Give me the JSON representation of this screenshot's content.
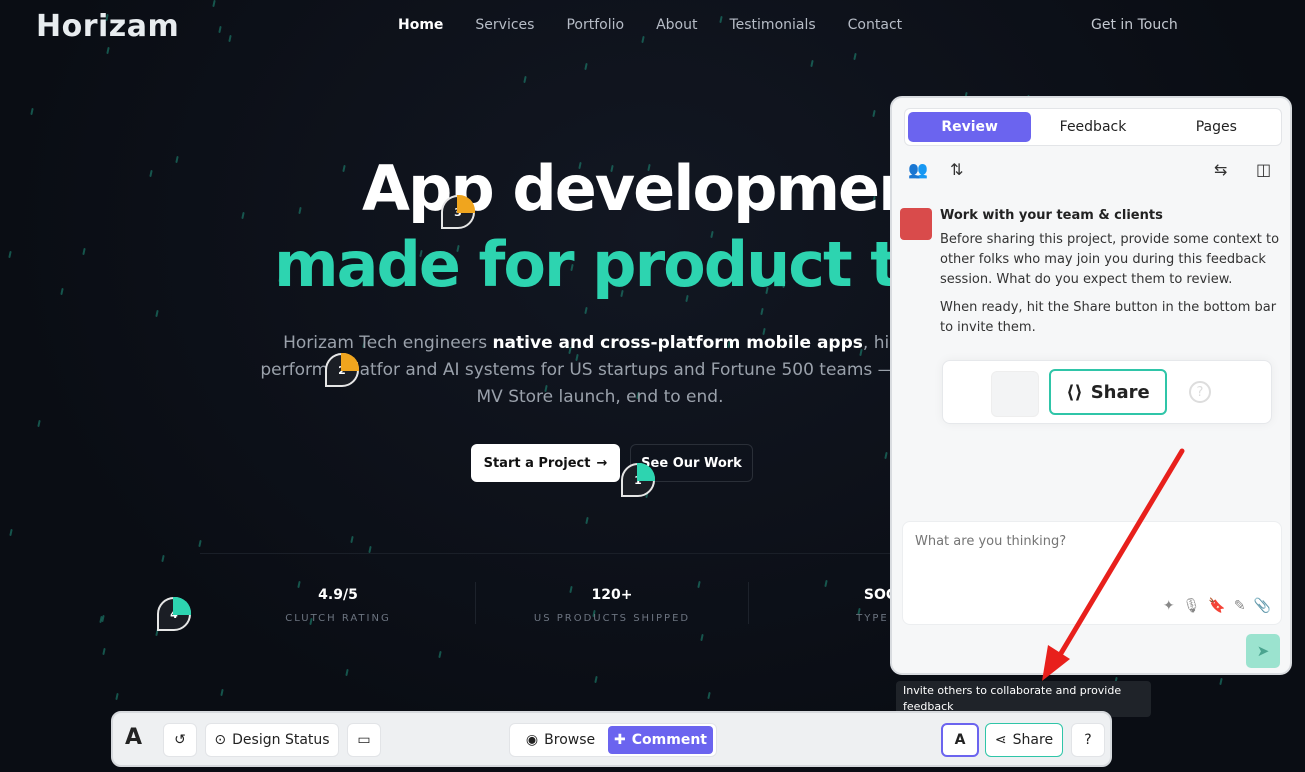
{
  "site": {
    "logo": "Horizam",
    "nav": [
      "Home",
      "Services",
      "Portfolio",
      "About",
      "Testimonials",
      "Contact"
    ],
    "cta": "Get in Touch",
    "hero_line1": "App development",
    "hero_line2": "made for product tear",
    "sub_pre": "Horizam Tech engineers ",
    "sub_bold": "native and cross-platform mobile apps",
    "sub_post": ", high-performa platfor   and AI systems for US startups and Fortune 500 teams — from MV Store launch, end to end.",
    "btn_start": "Start a Project",
    "btn_work": "See Our Work",
    "stats": [
      {
        "value": "4.9/5",
        "label": "CLUTCH RATING"
      },
      {
        "value": "120+",
        "label": "US PRODUCTS SHIPPED"
      },
      {
        "value": "SOC",
        "label": "TYPE II"
      }
    ],
    "pins": [
      "1",
      "2",
      "3",
      "4"
    ]
  },
  "panel": {
    "tabs": [
      "Review",
      "Feedback",
      "Pages"
    ],
    "message_title": "Work with your team & clients",
    "message_p1": "Before sharing this project, provide some context to other folks who may join you during this feedback session. What do you expect them to review.",
    "message_p2": "When ready, hit the Share button in the bottom bar to invite them.",
    "share_label": "Share",
    "input_placeholder": "What are you thinking?"
  },
  "tooltip": "Invite others to collaborate and provide feedback",
  "toolbar": {
    "design_status": "Design Status",
    "browse": "Browse",
    "comment": "Comment",
    "share": "Share"
  },
  "colors": {
    "accent_teal": "#2dd4b0",
    "accent_purple": "#6b64ef",
    "arrow_red": "#e8201c"
  }
}
